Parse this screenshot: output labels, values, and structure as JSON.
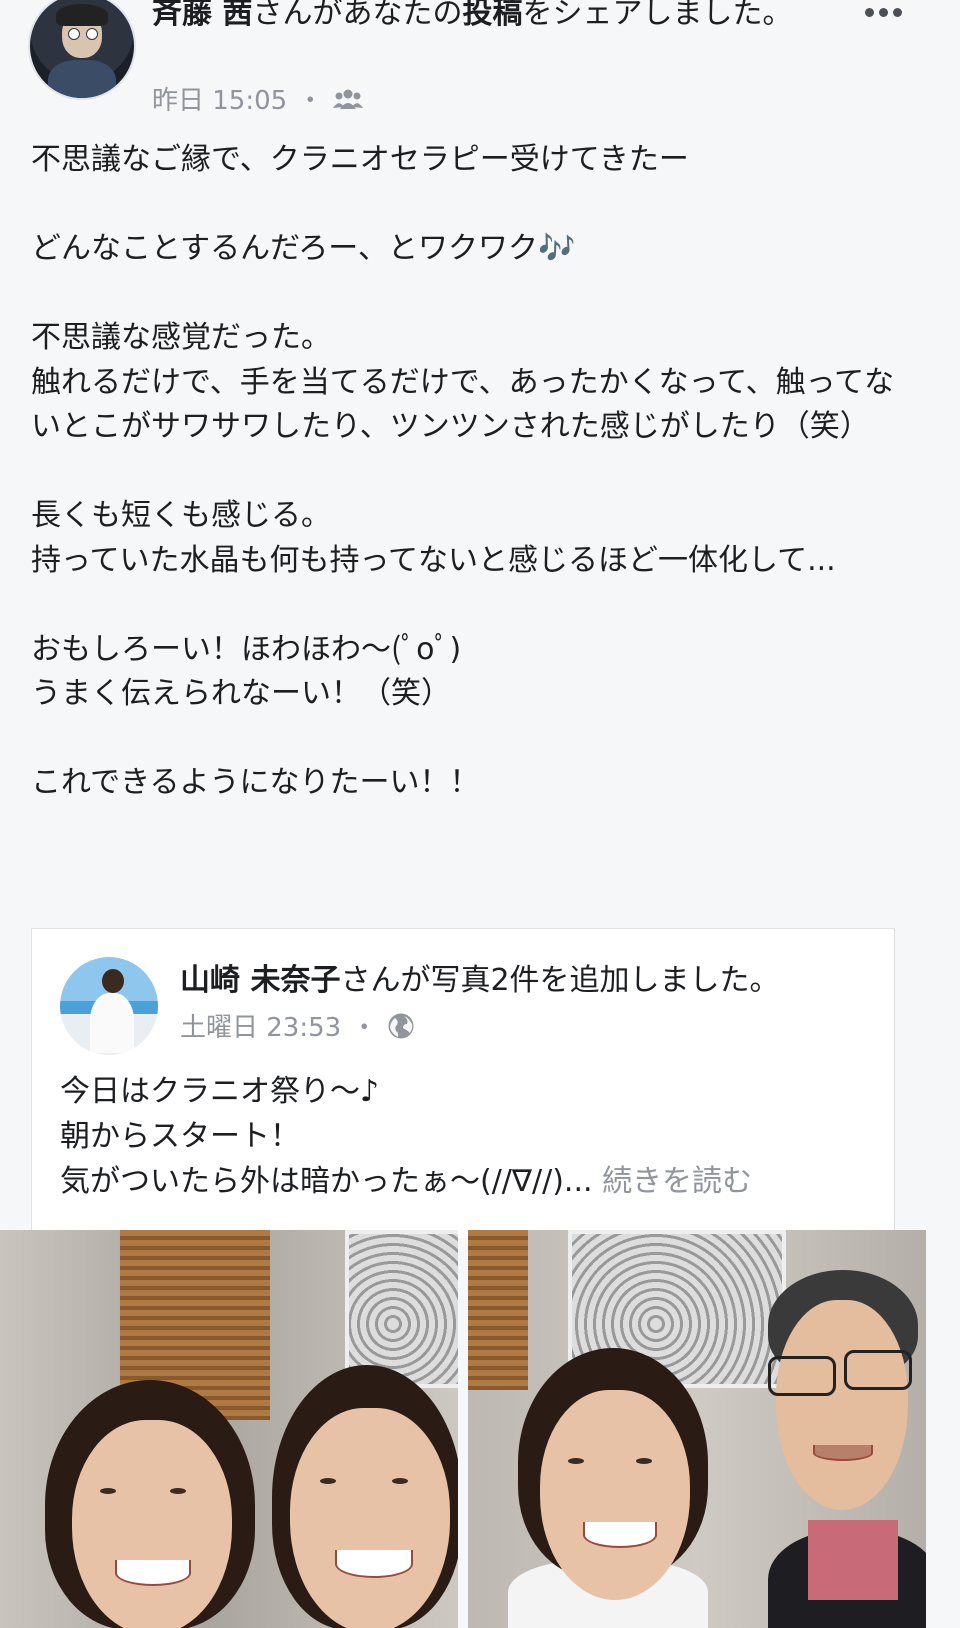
{
  "post": {
    "author": "斉藤 茜",
    "action_pre": "さんがあなたの",
    "action_bold": "投稿",
    "action_post": "をシェアしました。",
    "time": "昨日 15:05",
    "dot": "・",
    "audience_icon": "friends-icon",
    "more_icon": "more-dots-icon",
    "body_lines": [
      "不思議なご縁で、クラニオセラピー受けてきたー",
      "",
      "どんなことするんだろー、とワクワク🎶",
      "",
      "不思議な感覚だった。",
      "触れるだけで、手を当てるだけで、あったかくなって、触ってないとこがサワサワしたり、ツンツンされた感じがしたり（笑）",
      "",
      "長くも短くも感じる。",
      "持っていた水晶も何も持ってないと感じるほど一体化して...",
      "",
      "おもしろーい！ほわほわ〜(ﾟoﾟ)",
      "うまく伝えられなーい！（笑）",
      "",
      "これできるようになりたーい！！"
    ]
  },
  "shared": {
    "author": "山崎 未奈子",
    "action": "さんが写真2件を追加しました。",
    "time": "土曜日 23:53",
    "dot": "・",
    "audience_icon": "globe-icon",
    "lines": [
      "今日はクラニオ祭り〜♪",
      "朝からスタート！",
      "気がついたら外は暗かったぁ〜(//∇//)..."
    ],
    "read_more": "続きを読む"
  },
  "photos": [
    {
      "name": "photo-two-women"
    },
    {
      "name": "photo-woman-and-man"
    }
  ]
}
